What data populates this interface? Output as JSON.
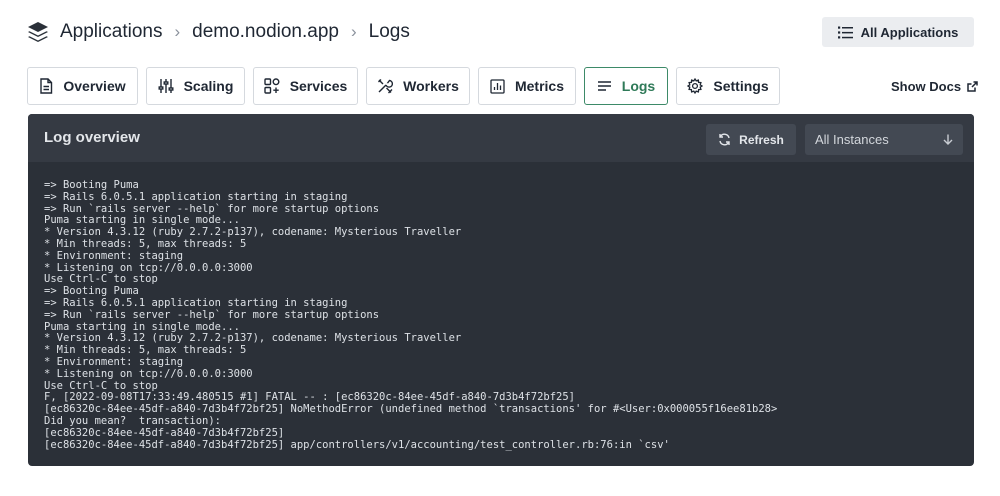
{
  "breadcrumb": {
    "items": [
      "Applications",
      "demo.nodion.app",
      "Logs"
    ],
    "separator": "›"
  },
  "header": {
    "all_apps_label": "All Applications"
  },
  "tabs": [
    {
      "label": "Overview",
      "icon": "document-icon",
      "active": false
    },
    {
      "label": "Scaling",
      "icon": "sliders-icon",
      "active": false
    },
    {
      "label": "Services",
      "icon": "services-icon",
      "active": false
    },
    {
      "label": "Workers",
      "icon": "tools-icon",
      "active": false
    },
    {
      "label": "Metrics",
      "icon": "chart-icon",
      "active": false
    },
    {
      "label": "Logs",
      "icon": "lines-icon",
      "active": true
    },
    {
      "label": "Settings",
      "icon": "gear-icon",
      "active": false
    }
  ],
  "show_docs_label": "Show Docs",
  "panel": {
    "title": "Log overview",
    "refresh_label": "Refresh",
    "instances_selected": "All Instances"
  },
  "colors": {
    "accent": "#3d8a68",
    "panel_bg": "#2b3038",
    "panel_header_bg": "#353a43"
  },
  "log_lines": [
    "=> Booting Puma",
    "=> Rails 6.0.5.1 application starting in staging",
    "=> Run `rails server --help` for more startup options",
    "Puma starting in single mode...",
    "* Version 4.3.12 (ruby 2.7.2-p137), codename: Mysterious Traveller",
    "* Min threads: 5, max threads: 5",
    "* Environment: staging",
    "* Listening on tcp://0.0.0.0:3000",
    "Use Ctrl-C to stop",
    "=> Booting Puma",
    "=> Rails 6.0.5.1 application starting in staging",
    "=> Run `rails server --help` for more startup options",
    "Puma starting in single mode...",
    "* Version 4.3.12 (ruby 2.7.2-p137), codename: Mysterious Traveller",
    "* Min threads: 5, max threads: 5",
    "* Environment: staging",
    "* Listening on tcp://0.0.0.0:3000",
    "Use Ctrl-C to stop",
    "F, [2022-09-08T17:33:49.480515 #1] FATAL -- : [ec86320c-84ee-45df-a840-7d3b4f72bf25]",
    "[ec86320c-84ee-45df-a840-7d3b4f72bf25] NoMethodError (undefined method `transactions' for #<User:0x000055f16ee81b28>",
    "Did you mean?  transaction):",
    "[ec86320c-84ee-45df-a840-7d3b4f72bf25]",
    "[ec86320c-84ee-45df-a840-7d3b4f72bf25] app/controllers/v1/accounting/test_controller.rb:76:in `csv'"
  ]
}
